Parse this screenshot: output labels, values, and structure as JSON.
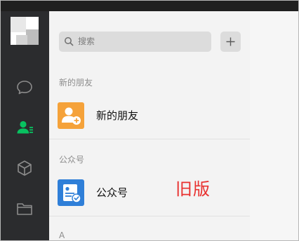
{
  "search": {
    "placeholder": "搜索"
  },
  "sections": {
    "new_friends_header": "新的朋友",
    "official_accounts_header": "公众号",
    "alpha_header": "A"
  },
  "rows": {
    "new_friends": {
      "label": "新的朋友",
      "icon": "add-friend-icon",
      "icon_color": "#f5a23a"
    },
    "official_accounts": {
      "label": "公众号",
      "icon": "official-account-icon",
      "icon_color": "#2f7fd8"
    }
  },
  "sidebar": {
    "items": [
      {
        "icon": "chat-icon",
        "active": false
      },
      {
        "icon": "contacts-icon",
        "active": true
      },
      {
        "icon": "cube-icon",
        "active": false
      },
      {
        "icon": "folder-icon",
        "active": false
      }
    ],
    "active_color": "#08c160"
  },
  "annotation": {
    "text": "旧版",
    "color": "#e8312f"
  }
}
